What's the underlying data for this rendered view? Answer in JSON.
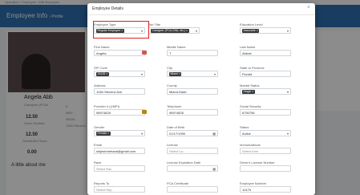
{
  "background": {
    "breadcrumb": "Operation › Employee › Edit Employee",
    "header_title": "Employee Info",
    "header_sub": "› Profile",
    "profile_name": "Angela Abb",
    "profile_role": "Caregiver (PCA/I",
    "stats": [
      {
        "value": "12.50",
        "label": "Hours Worked"
      },
      {
        "value": "12.50",
        "label": "Scheduled Hours"
      },
      {
        "value": "0.00",
        "label": ""
      }
    ],
    "about": "A little about me",
    "contact_lines": [
      "#",
      "9897...",
      "98436...",
      "1284 Stevens..."
    ]
  },
  "modal": {
    "title": "Employee Details",
    "close": "×",
    "fields": {
      "employee_type": {
        "label": "Employee Type",
        "tag": "Regular Employee"
      },
      "job_title": {
        "label": "Job Title",
        "tag": "Caregiver (PCA,CNA, etc.)"
      },
      "education_level": {
        "label": "Education Level",
        "tag": "Associate"
      },
      "first_name": {
        "label": "First Name",
        "value": "Angela"
      },
      "middle_name": {
        "label": "Middle Name",
        "value": "T"
      },
      "last_name": {
        "label": "Last Name",
        "value": "Abbott"
      },
      "zip_code": {
        "label": "ZIP Code",
        "tag": "33128"
      },
      "city": {
        "label": "City",
        "tag": "Miami"
      },
      "state": {
        "label": "State or Province",
        "value": "Florida"
      },
      "address": {
        "label": "Address",
        "value": "1284 Stevens Ave"
      },
      "county": {
        "label": "County",
        "value": "Miami-Dade"
      },
      "marital_status": {
        "label": "Marital Status",
        "tag": "Single"
      },
      "provider_num": {
        "label": "Provider # (UMPI)",
        "value": "98974828"
      },
      "telephone": {
        "label": "Telephone",
        "value": "98974828"
      },
      "social_security": {
        "label": "Social Security",
        "value": "8750756"
      },
      "gender": {
        "label": "Gender",
        "tag": "Female"
      },
      "dob": {
        "label": "Date of Birth",
        "value": "01/17/1990"
      },
      "status": {
        "label": "Status",
        "value": "Active"
      },
      "email": {
        "label": "Email",
        "value": "shijeshmeharai@gmail.com"
      },
      "license": {
        "label": "License",
        "placeholder": "Select Lic..."
      },
      "immunizations": {
        "label": "Immunizations",
        "placeholder": "Select Imm"
      },
      "race": {
        "label": "Race",
        "placeholder": "Select Rac"
      },
      "license_exp": {
        "label": "License Expiration Date",
        "value": ""
      },
      "drivers_license": {
        "label": "Driver's License Number",
        "value": ""
      },
      "reports_to": {
        "label": "Reports To",
        "placeholder": "Select Rep"
      },
      "pca_cert": {
        "label": "PCA Certificate",
        "value": ""
      },
      "employee_number": {
        "label": "Employee Number",
        "value": "10179"
      }
    }
  },
  "colors": {
    "header_blue": "#2f6fb0",
    "highlight_red": "#e02020",
    "tag_dark": "#3a3a3a",
    "icon_red": "#d9534f",
    "icon_tan": "#b8860b"
  },
  "icons": {
    "clear": "×",
    "caret": "▾",
    "calendar": "▦"
  }
}
